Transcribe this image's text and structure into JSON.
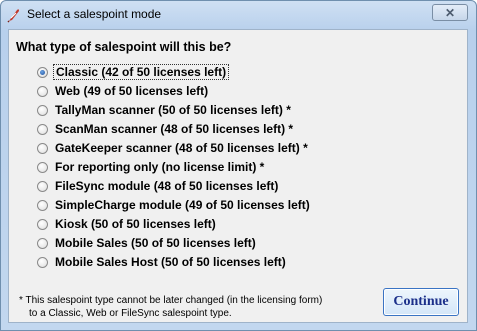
{
  "window": {
    "title": "Select a salespoint mode",
    "close_label": "✕"
  },
  "dialog": {
    "question": "What type of salespoint will this be?",
    "options": [
      {
        "label": "Classic  (42 of 50 licenses left)",
        "checked": true
      },
      {
        "label": "Web  (49 of 50 licenses left)",
        "checked": false
      },
      {
        "label": "TallyMan scanner  (50 of 50 licenses left) *",
        "checked": false
      },
      {
        "label": "ScanMan scanner  (48 of 50 licenses left) *",
        "checked": false
      },
      {
        "label": "GateKeeper scanner  (48 of 50 licenses left) *",
        "checked": false
      },
      {
        "label": "For reporting only  (no license limit) *",
        "checked": false
      },
      {
        "label": "FileSync module   (48 of 50 licenses left)",
        "checked": false
      },
      {
        "label": "SimpleCharge module  (49 of 50 licenses left)",
        "checked": false
      },
      {
        "label": "Kiosk  (50 of 50 licenses left)",
        "checked": false
      },
      {
        "label": "Mobile Sales  (50 of 50 licenses left)",
        "checked": false
      },
      {
        "label": "Mobile Sales Host  (50 of 50 licenses left)",
        "checked": false
      }
    ],
    "footnote_line1": "* This salespoint type cannot be later changed (in the licensing form)",
    "footnote_line2": "to a Classic, Web or FileSync salespoint type.",
    "continue_label": "Continue"
  },
  "icons": {
    "app": "app-feather-icon",
    "close": "close-icon"
  }
}
